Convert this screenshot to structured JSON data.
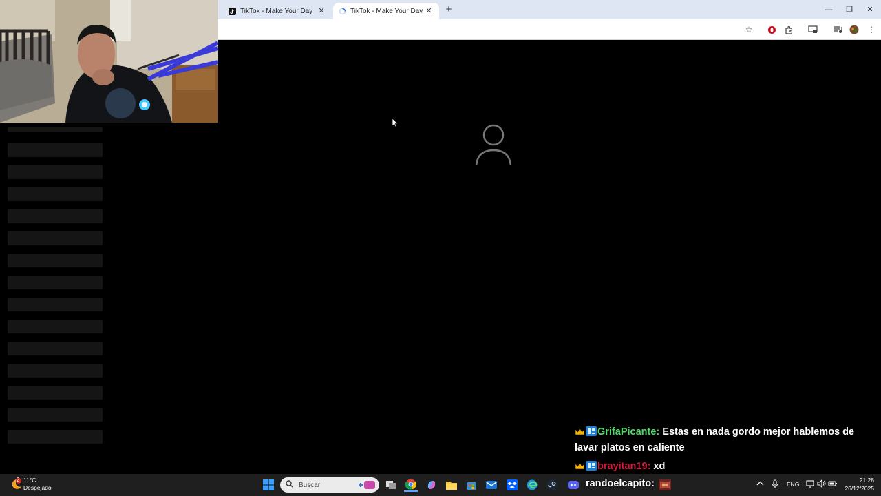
{
  "browser": {
    "tabs": [
      {
        "label": "TikTok - Make Your Day",
        "active": false
      },
      {
        "label": "TikTok - Make Your Day",
        "active": true
      }
    ],
    "new_tab_label": "+",
    "window": {
      "minimize": "—",
      "restore": "❐",
      "close": "✕"
    },
    "toolbar_icons": [
      "bookmark-star-icon",
      "opera-icon",
      "extensions-icon",
      "cast-icon",
      "media-icon",
      "profile-avatar-icon",
      "menu-icon"
    ]
  },
  "chat": {
    "messages": [
      {
        "user": "GrifaPicante:",
        "text": " Estas en nada gordo mejor hablemos de lavar platos en caliente",
        "user_color": "#4ddc6a"
      },
      {
        "user": "brayitan19:",
        "text": " xd",
        "user_color": "#d01b3c"
      }
    ]
  },
  "taskbar": {
    "weather": {
      "temp": "11°C",
      "condition": "Despejado",
      "badge": "2"
    },
    "search_placeholder": "Buscar",
    "streamer_name": "randoelcapito:",
    "language": "ENG",
    "time": "21:28",
    "date": "26/12/2025"
  },
  "colors": {
    "accent_blue": "#0a64d8",
    "tab_bar": "#dfe6f3",
    "taskbar": "#1f1f1f"
  }
}
